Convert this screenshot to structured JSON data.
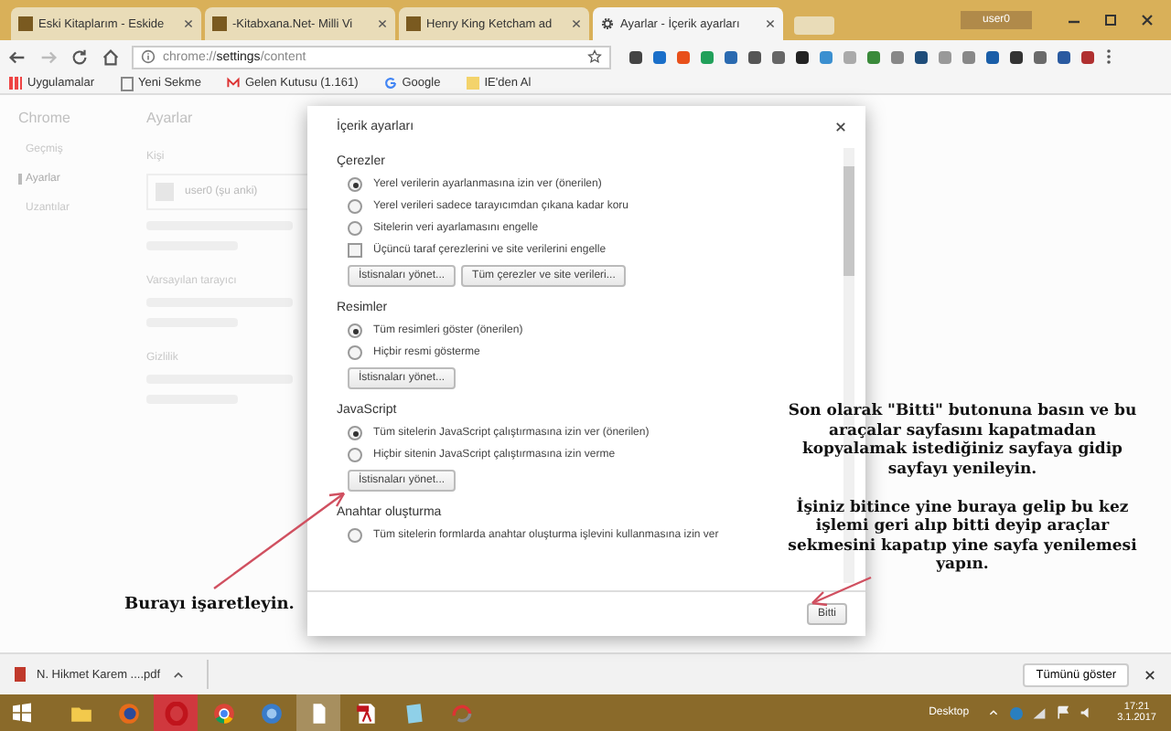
{
  "browser": {
    "tabs": [
      {
        "title": "Eski Kitaplarım - Eskide",
        "selected": false
      },
      {
        "title": "-Kitabxana.Net- Milli Vi",
        "selected": false
      },
      {
        "title": "Henry King Ketcham ad",
        "selected": false
      },
      {
        "title": "Ayarlar - İçerik ayarları",
        "selected": true
      }
    ],
    "user": "user0",
    "address": "chrome://**settings**/content",
    "bookmarks": [
      "Uygulamalar",
      "Yeni Sekme",
      "Gelen Kutusu (1.161)",
      "Google",
      "IE'den Al"
    ]
  },
  "settings_page": {
    "brand": "Chrome",
    "title": "Ayarlar",
    "sidebar": [
      {
        "label": "Geçmiş",
        "selected": false
      },
      {
        "label": "Ayarlar",
        "selected": true
      },
      {
        "label": "Uzantılar",
        "selected": false
      }
    ],
    "sections": [
      {
        "title": "Kişi",
        "person": "user0 (şu anki)"
      },
      {
        "title": "Varsayılan tarayıcı"
      },
      {
        "title": "Gizlilik"
      }
    ]
  },
  "dialog": {
    "title": "İçerik ayarları",
    "sections": [
      {
        "title": "Çerezler",
        "items": [
          {
            "kind": "radio",
            "label": "Yerel verilerin ayarlanmasına izin ver (önerilen)",
            "selected": true
          },
          {
            "kind": "radio",
            "label": "Yerel verileri sadece tarayıcımdan çıkana kadar koru",
            "selected": false
          },
          {
            "kind": "radio",
            "label": "Sitelerin veri ayarlamasını engelle",
            "selected": false
          },
          {
            "kind": "checkbox",
            "label": "Üçüncü taraf çerezlerini ve site verilerini engelle",
            "checked": false
          },
          {
            "kind": "buttons",
            "buttons": [
              "İstisnaları yönet...",
              "Tüm çerezler ve site verileri..."
            ]
          }
        ]
      },
      {
        "title": "Resimler",
        "items": [
          {
            "kind": "radio",
            "label": "Tüm resimleri göster (önerilen)",
            "selected": true
          },
          {
            "kind": "radio",
            "label": "Hiçbir resmi gösterme",
            "selected": false
          },
          {
            "kind": "buttons",
            "buttons": [
              "İstisnaları yönet..."
            ]
          }
        ]
      },
      {
        "title": "JavaScript",
        "items": [
          {
            "kind": "radio",
            "label": "Tüm sitelerin JavaScript çalıştırmasına izin ver (önerilen)",
            "selected": true
          },
          {
            "kind": "radio",
            "label": "Hiçbir sitenin JavaScript çalıştırmasına izin verme",
            "selected": false
          },
          {
            "kind": "buttons",
            "buttons": [
              "İstisnaları yönet..."
            ]
          }
        ]
      },
      {
        "title": "Anahtar oluşturma",
        "items": [
          {
            "kind": "radio",
            "label": "Tüm sitelerin formlarda anahtar oluşturma işlevini kullanmasına izin ver",
            "selected": false
          }
        ]
      }
    ],
    "done_button": "Bitti"
  },
  "annotations": {
    "instructions": [
      "Son olarak \"Bitti\" butonuna basın ve bu araçalar sayfasını kapatmadan kopyalamak istediğiniz sayfaya gidip sayfayı yenileyin.",
      "İşiniz bitince yine buraya gelip bu kez işlemi geri alıp bitti deyip araçlar sekmesini kapatıp yine sayfa yenilemesi yapın."
    ],
    "mark_here": "Burayı işaretleyin."
  },
  "download_bar": {
    "file": "N. Hikmet Karem ....pdf",
    "show_all": "Tümünü göster"
  },
  "taskbar": {
    "desktop": "Desktop",
    "time": "17:21",
    "date": "3.1.2017"
  }
}
